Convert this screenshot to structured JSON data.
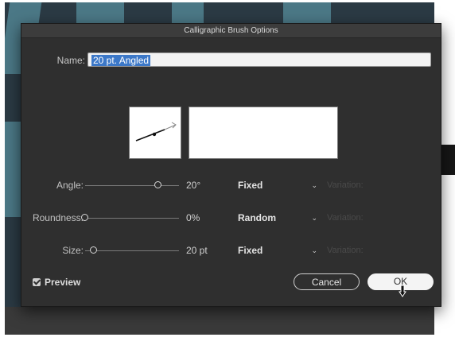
{
  "dialog": {
    "title": "Calligraphic Brush Options",
    "name_label": "Name:",
    "name_value": "20 pt. Angled"
  },
  "params": [
    {
      "label": "Angle:",
      "value": "20°",
      "select": "Fixed",
      "variation": "Variation:",
      "slider_fraction": 0.78
    },
    {
      "label": "Roundness:",
      "value": "0%",
      "select": "Random",
      "variation": "Variation:",
      "slider_fraction": 0.0
    },
    {
      "label": "Size:",
      "value": "20 pt",
      "select": "Fixed",
      "variation": "Variation:",
      "slider_fraction": 0.09
    }
  ],
  "preview": {
    "label": "Preview",
    "checked": true
  },
  "buttons": {
    "cancel": "Cancel",
    "ok": "OK"
  },
  "icons": {
    "chevron": "chevron-down-icon",
    "check": "checkmark-icon",
    "cursor": "pointer-cursor-icon"
  },
  "colors": {
    "dialog_bg": "#2f2f2f",
    "selection": "#3c78c8"
  }
}
